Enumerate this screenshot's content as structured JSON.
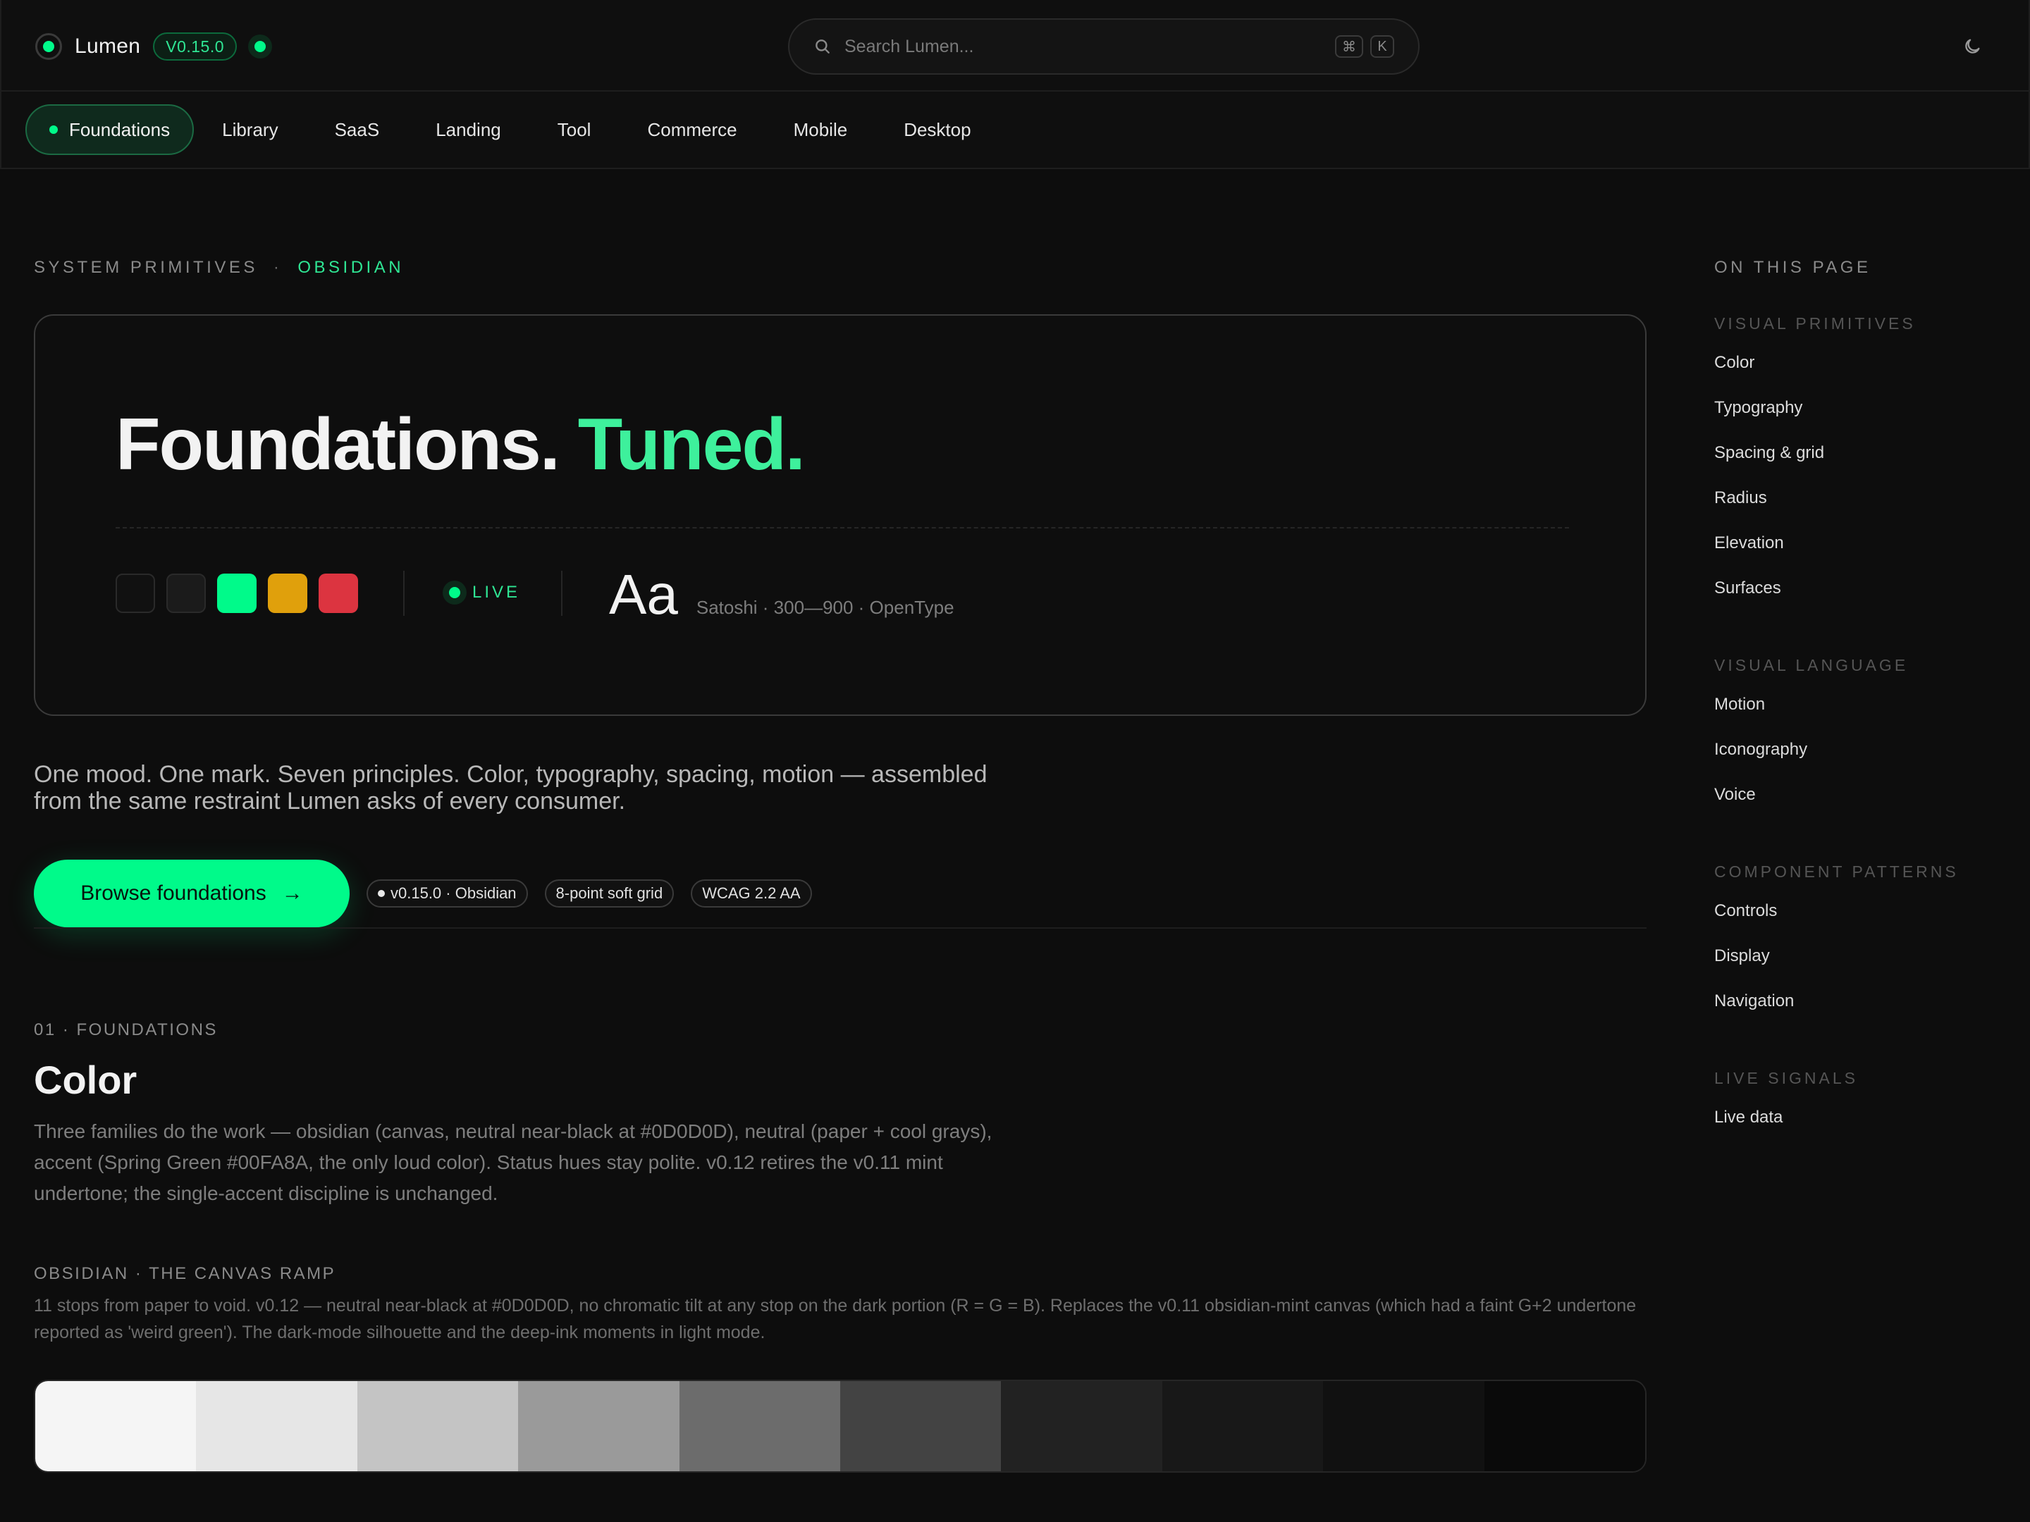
{
  "brand": {
    "name": "Lumen",
    "version": "V0.15.0"
  },
  "search": {
    "placeholder": "Search Lumen...",
    "shortcut_mod": "⌘",
    "shortcut_key": "K"
  },
  "nav": {
    "tabs": [
      "Foundations",
      "Library",
      "SaaS",
      "Landing",
      "Tool",
      "Commerce",
      "Mobile",
      "Desktop"
    ],
    "active": "Foundations"
  },
  "eyebrow": {
    "section": "SYSTEM PRIMITIVES",
    "separator": "·",
    "theme": "OBSIDIAN"
  },
  "hero": {
    "title_main": "Foundations.",
    "title_accent": "Tuned.",
    "swatches": [
      "#111111",
      "#1b1b1b",
      "#00fa8a",
      "#e0a00c",
      "#dc3440"
    ],
    "live_label": "LIVE",
    "type_sample": "Aa",
    "type_meta": "Satoshi · 300—900 · OpenType"
  },
  "lede": "One mood. One mark. Seven principles. Color, typography, spacing, motion — assembled from the same restraint Lumen asks of every consumer.",
  "cta": {
    "label": "Browse foundations",
    "arrow": "→"
  },
  "chips": [
    "v0.15.0 · Obsidian",
    "8-point soft grid",
    "WCAG 2.2 AA"
  ],
  "section": {
    "eyebrow": "01 · FOUNDATIONS",
    "title": "Color",
    "body": "Three families do the work — obsidian (canvas, neutral near-black at #0D0D0D), neutral (paper + cool grays), accent (Spring Green #00FA8A, the only loud color). Status hues stay polite. v0.12 retires the v0.11 mint undertone; the single-accent discipline is unchanged."
  },
  "ramp": {
    "eyebrow": "OBSIDIAN · THE CANVAS RAMP",
    "body": "11 stops from paper to void. v0.12 — neutral near-black at #0D0D0D, no chromatic tilt at any stop on the dark portion (R = G = B). Replaces the v0.11 obsidian-mint canvas (which had a faint G+2 undertone reported as 'weird green'). The dark-mode silhouette and the deep-ink moments in light mode.",
    "stops": [
      "#f5f5f5",
      "#e6e6e6",
      "#c4c4c4",
      "#9a9a9a",
      "#6c6c6c",
      "#434343",
      "#222222",
      "#181818",
      "#111111",
      "#0a0a0a"
    ]
  },
  "toc": {
    "title": "ON THIS PAGE",
    "groups": [
      {
        "heading": "VISUAL PRIMITIVES",
        "items": [
          "Color",
          "Typography",
          "Spacing & grid",
          "Radius",
          "Elevation",
          "Surfaces"
        ]
      },
      {
        "heading": "VISUAL LANGUAGE",
        "items": [
          "Motion",
          "Iconography",
          "Voice"
        ]
      },
      {
        "heading": "COMPONENT PATTERNS",
        "items": [
          "Controls",
          "Display",
          "Navigation"
        ]
      },
      {
        "heading": "LIVE SIGNALS",
        "items": [
          "Live data"
        ]
      }
    ]
  },
  "colors": {
    "accent": "#00fa8a",
    "canvas": "#0d0d0d"
  },
  "icons": {
    "search": "search-icon",
    "theme": "moon-icon",
    "arrow": "arrow-right-icon"
  }
}
